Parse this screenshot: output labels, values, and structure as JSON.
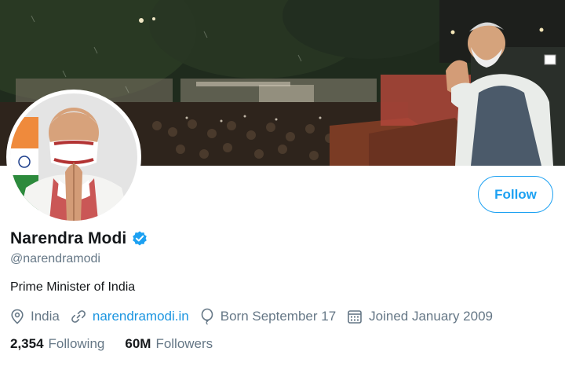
{
  "profile": {
    "display_name": "Narendra Modi",
    "verified": true,
    "handle": "@narendramodi",
    "bio": "Prime Minister of India"
  },
  "follow_button": {
    "label": "Follow"
  },
  "meta": {
    "location": {
      "icon": "location-pin-icon",
      "text": "India"
    },
    "website": {
      "icon": "link-icon",
      "text": "narendramodi.in"
    },
    "birthday": {
      "icon": "balloon-icon",
      "text": "Born September 17"
    },
    "joined": {
      "icon": "calendar-icon",
      "text": "Joined January 2009"
    }
  },
  "stats": {
    "following": {
      "count": "2,354",
      "label": "Following"
    },
    "followers": {
      "count": "60M",
      "label": "Followers"
    }
  },
  "colors": {
    "accent": "#1da1f2",
    "link": "#1b95e0",
    "secondary_text": "#657786",
    "primary_text": "#14171a"
  }
}
